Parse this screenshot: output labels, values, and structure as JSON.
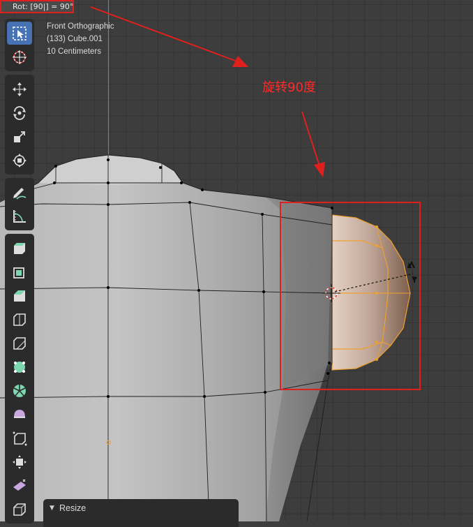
{
  "operator_status": "Rot: [90|] = 90°",
  "viewport_info": {
    "view_name": "Front Orthographic",
    "object_line": "(133) Cube.001",
    "scale_line": "10 Centimeters"
  },
  "annotation": {
    "label": "旋转90度",
    "color": "#e0201c"
  },
  "redo_panel": {
    "title": "Resize"
  },
  "toolbar": {
    "groups": [
      [
        "select-box-icon",
        "cursor-icon"
      ],
      [
        "move-icon",
        "rotate-icon",
        "scale-icon",
        "transform-icon"
      ],
      [
        "annotate-icon",
        "measure-icon"
      ],
      [
        "add-cube-icon",
        "extrude-region-icon",
        "inset-faces-icon",
        "bevel-icon",
        "loop-cut-icon",
        "knife-icon",
        "poly-build-icon",
        "spin-icon",
        "smooth-icon",
        "edge-slide-icon",
        "shrink-fatten-icon",
        "shear-icon",
        "rip-region-icon"
      ]
    ],
    "active": "select-box-icon"
  },
  "colors": {
    "accent_blue": "#4772b3",
    "selection_orange": "#f0a030",
    "annotation_red": "#e0201c",
    "viewport_bg": "#3d3d3d"
  }
}
